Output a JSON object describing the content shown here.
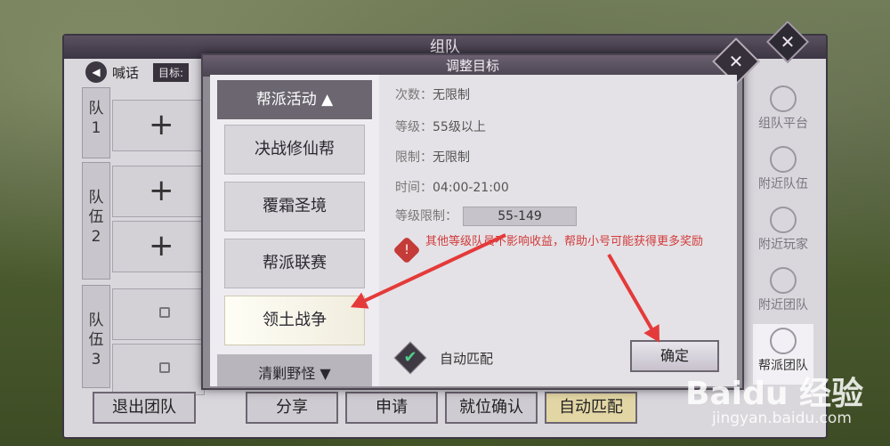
{
  "team_panel": {
    "title": "组队",
    "shout_label": "喊话",
    "target_label": "目标:",
    "groups": [
      {
        "label": "队\n1"
      },
      {
        "label": "队\n伍\n2"
      },
      {
        "label": "队\n伍\n3"
      }
    ],
    "slot_plus": "+",
    "side_nav": [
      {
        "label": "组队平台"
      },
      {
        "label": "附近队伍"
      },
      {
        "label": "附近玩家"
      },
      {
        "label": "附近团队"
      },
      {
        "label": "帮派团队"
      }
    ],
    "bottom_buttons": [
      {
        "label": "退出团队"
      },
      {
        "label": "分享"
      },
      {
        "label": "申请"
      },
      {
        "label": "就位确认"
      },
      {
        "label": "自动匹配"
      }
    ]
  },
  "modal": {
    "title": "调整目标",
    "category_header": "帮派活动",
    "categories": [
      "决战修仙帮",
      "覆霜圣境",
      "帮派联赛",
      "领土战争"
    ],
    "category_footer": "清剿野怪",
    "info": [
      {
        "key": "次数：",
        "value": "无限制"
      },
      {
        "key": "等级：",
        "value": "55级以上"
      },
      {
        "key": "限制：",
        "value": "无限制"
      },
      {
        "key": "时间：",
        "value": "04:00-21:00"
      }
    ],
    "level_limit_label": "等级限制：",
    "level_limit_value": "55-149",
    "warning": "其他等级队员不影响收益，帮助小号可能获得更多奖励",
    "auto_match_label": "自动匹配",
    "confirm_label": "确定"
  },
  "watermark": {
    "logo": "Baidu 经验",
    "url": "jingyan.baidu.com"
  },
  "colors": {
    "warning": "#d23b3b",
    "annotation_arrow": "#e53a3a",
    "check": "#4fcf8d"
  }
}
